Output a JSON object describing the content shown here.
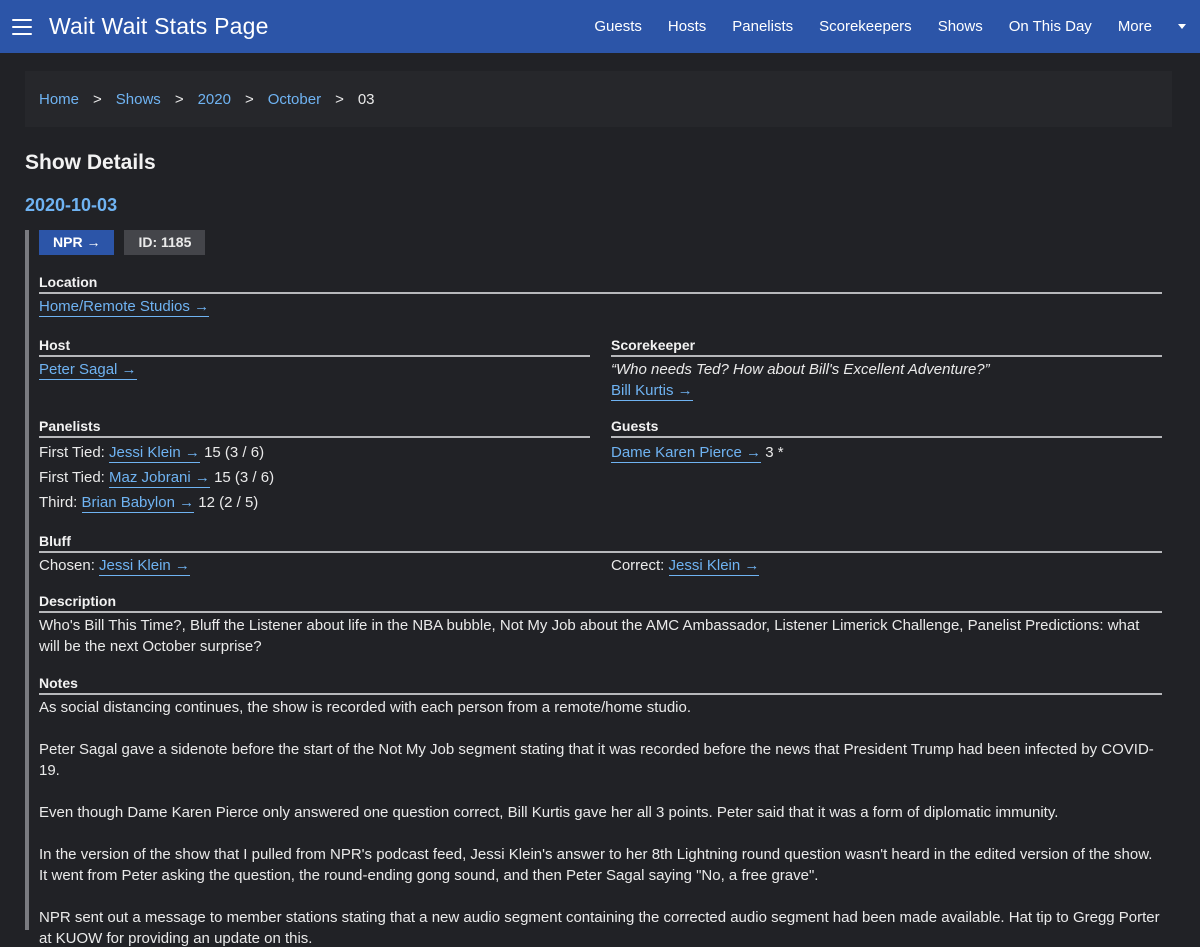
{
  "header": {
    "title": "Wait Wait Stats Page",
    "nav": [
      "Guests",
      "Hosts",
      "Panelists",
      "Scorekeepers",
      "Shows",
      "On This Day"
    ],
    "more_label": "More"
  },
  "breadcrumb": {
    "home": "Home",
    "shows": "Shows",
    "year": "2020",
    "month": "October",
    "day": "03",
    "separator": ">"
  },
  "page_title": "Show Details",
  "show": {
    "date": "2020-10-03",
    "npr_badge": "NPR →",
    "id_badge": "ID: 1185",
    "location_label": "Location",
    "location": "Home/Remote Studios →",
    "host_label": "Host",
    "host": "Peter Sagal →",
    "scorekeeper_label": "Scorekeeper",
    "scorekeeper_quote": "“Who needs Ted? How about Bill's Excellent Adventure?”",
    "scorekeeper": "Bill Kurtis →",
    "panelists_label": "Panelists",
    "panelists": [
      {
        "rank": "First Tied:",
        "name": "Jessi Klein →",
        "score": "15 (3 / 6)"
      },
      {
        "rank": "First Tied:",
        "name": "Maz Jobrani →",
        "score": "15 (3 / 6)"
      },
      {
        "rank": "Third:",
        "name": "Brian Babylon →",
        "score": "12 (2 / 5)"
      }
    ],
    "guests_label": "Guests",
    "guest": {
      "name": "Dame Karen Pierce →",
      "score": "3 *"
    },
    "bluff_label": "Bluff",
    "bluff_chosen_label": "Chosen:",
    "bluff_chosen": "Jessi Klein →",
    "bluff_correct_label": "Correct:",
    "bluff_correct": "Jessi Klein →",
    "description_label": "Description",
    "description": "Who's Bill This Time?, Bluff the Listener about life in the NBA bubble, Not My Job about the AMC Ambassador, Listener Limerick Challenge, Panelist Predictions: what will be the next October surprise?",
    "notes_label": "Notes",
    "notes": [
      "As social distancing continues, the show is recorded with each person from a remote/home studio.",
      "Peter Sagal gave a sidenote before the start of the Not My Job segment stating that it was recorded before the news that President Trump had been infected by COVID-19.",
      "Even though Dame Karen Pierce only answered one question correct, Bill Kurtis gave her all 3 points. Peter said that it was a form of diplomatic immunity.",
      "In the version of the show that I pulled from NPR's podcast feed, Jessi Klein's answer to her 8th Lightning round question wasn't heard in the edited version of the show. It went from Peter asking the question, the round-ending gong sound, and then Peter Sagal saying \"No, a free grave\".",
      "NPR sent out a message to member stations stating that a new audio segment containing the corrected audio segment had been made available. Hat tip to Gregg Porter at KUOW for providing an update on this."
    ]
  }
}
